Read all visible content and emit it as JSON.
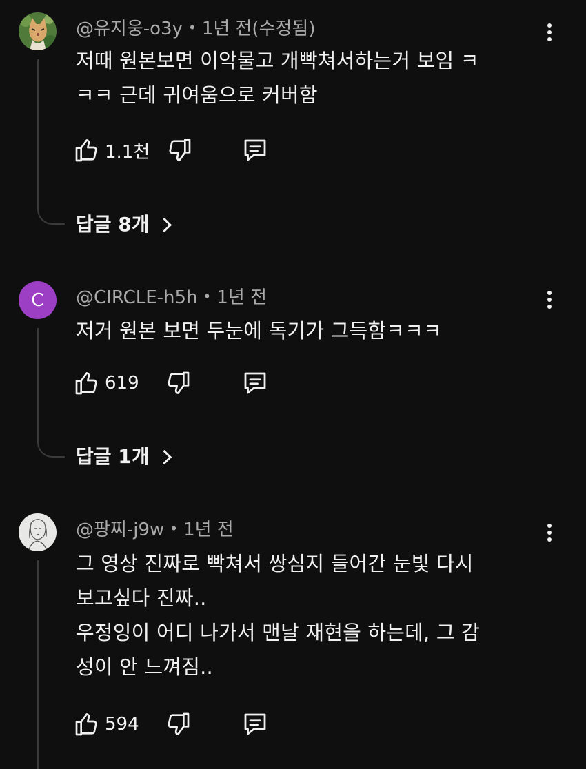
{
  "comments": [
    {
      "author": "@유지웅-o3y",
      "time": "1년 전(수정됨)",
      "text": "저때 원본보면 이악물고 개빡쳐서하는거 보임 ㅋ\nㅋㅋ 근데 귀여움으로 커버함",
      "likes": "1.1천",
      "replies_label": "답글 8개",
      "avatar_icon": "cat-avatar-icon"
    },
    {
      "author": "@CIRCLE-h5h",
      "time": "1년 전",
      "text": "저거 원본 보면 두눈에 독기가 그득함ㅋㅋㅋ",
      "likes": "619",
      "replies_label": "답글 1개",
      "avatar_letter": "C",
      "avatar_color": "#9c3fc4"
    },
    {
      "author": "@팡찌-j9w",
      "time": "1년 전",
      "text": "그 영상 진짜로 빡쳐서 쌍심지 들어간 눈빛 다시\n보고싶다 진짜..\n우정잉이 어디 나가서 맨날 재현을 하는데, 그 감\n성이 안 느껴짐..",
      "likes": "594",
      "avatar_icon": "sketch-avatar-icon"
    }
  ],
  "separator_dot": "•",
  "icons": {
    "like": "thumbs-up-icon",
    "dislike": "thumbs-down-icon",
    "reply": "comment-icon",
    "menu": "more-vertical-icon",
    "chevron": "chevron-right-icon"
  },
  "colors": {
    "background": "#0f0f0f",
    "text": "#f1f1f1",
    "secondary_text": "#aaaaaa",
    "thread_line": "#3a3a3a"
  }
}
